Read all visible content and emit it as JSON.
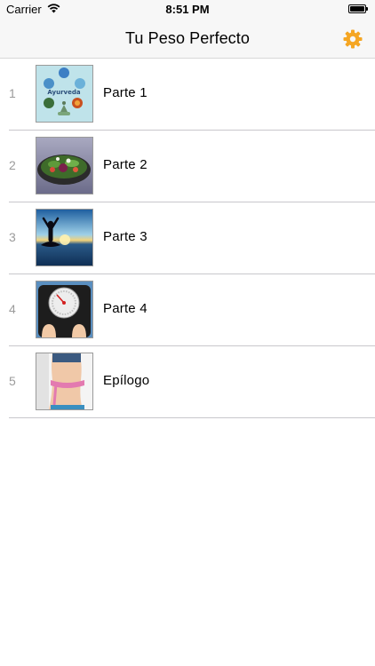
{
  "status_bar": {
    "carrier": "Carrier",
    "time": "8:51 PM"
  },
  "nav": {
    "title": "Tu Peso Perfecto",
    "settings_icon": "gear-icon",
    "accent_color": "#f5a623"
  },
  "list": {
    "items": [
      {
        "number": "1",
        "label": "Parte 1",
        "thumbnail": "ayurveda-diagram"
      },
      {
        "number": "2",
        "label": "Parte 2",
        "thumbnail": "salad-bowl"
      },
      {
        "number": "3",
        "label": "Parte 3",
        "thumbnail": "meditation-silhouette"
      },
      {
        "number": "4",
        "label": "Parte 4",
        "thumbnail": "bathroom-scale"
      },
      {
        "number": "5",
        "label": "Epílogo",
        "thumbnail": "measuring-tape-waist"
      }
    ]
  }
}
